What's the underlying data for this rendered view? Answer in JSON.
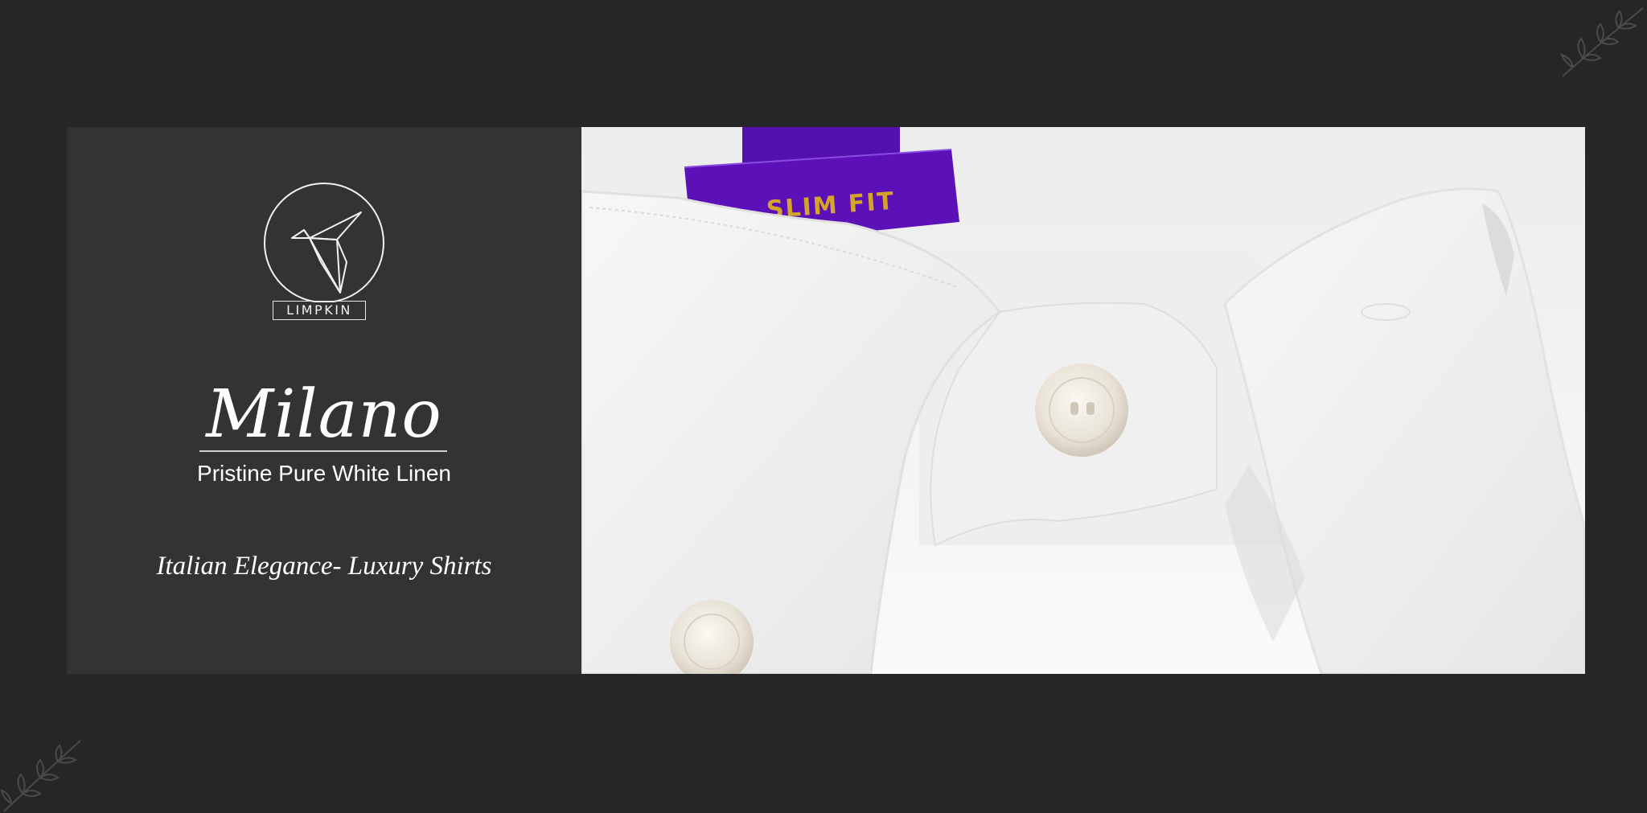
{
  "brand": {
    "logo_label": "LIMPKIN"
  },
  "collection": {
    "name": "Milano",
    "fabric": "Pristine Pure White Linen",
    "tagline": "Italian Elegance- Luxury Shirts"
  },
  "product_image": {
    "tag_text": "SLIM FIT",
    "tag_color": "#5b10b8",
    "tag_text_color": "#d4a52a"
  },
  "colors": {
    "background": "#262626",
    "panel": "#333333",
    "text": "#ffffff"
  }
}
